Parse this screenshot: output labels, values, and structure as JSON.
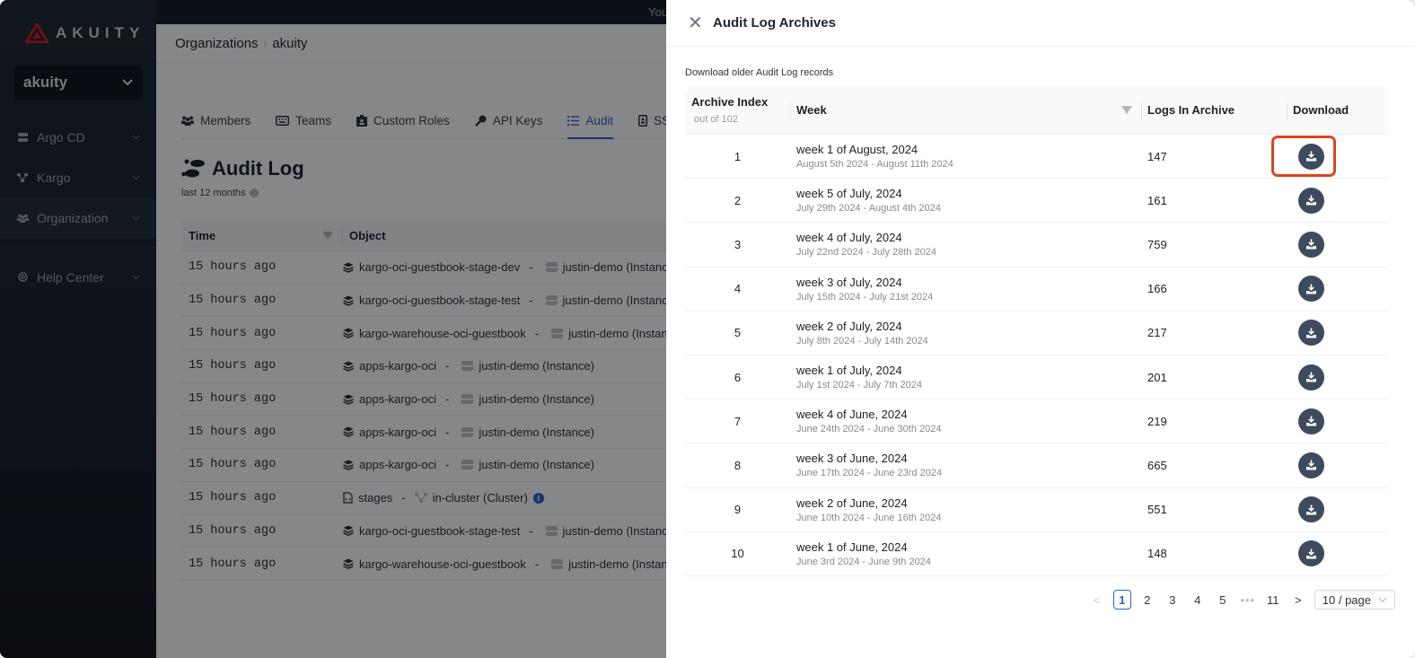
{
  "brand": {
    "name": "AKUITY",
    "accent": "#c4212b"
  },
  "sidebar": {
    "org_selector": "akuity",
    "items": [
      {
        "label": "Argo CD",
        "icon": "server-icon",
        "active": false
      },
      {
        "label": "Kargo",
        "icon": "network-icon",
        "active": false
      },
      {
        "label": "Organization",
        "icon": "users-icon",
        "active": true
      },
      {
        "label": "Help Center",
        "icon": "lifebuoy-icon",
        "active": false
      }
    ]
  },
  "topbar": {
    "user_text": "You"
  },
  "breadcrumb": {
    "root": "Organizations",
    "current": "akuity"
  },
  "tabs": [
    {
      "label": "Members",
      "icon": "users-icon"
    },
    {
      "label": "Teams",
      "icon": "keyboard-icon"
    },
    {
      "label": "Custom Roles",
      "icon": "id-badge-icon"
    },
    {
      "label": "API Keys",
      "icon": "key-icon"
    },
    {
      "label": "Audit",
      "icon": "list-icon",
      "active": true
    },
    {
      "label": "SSO",
      "icon": "id-card-icon"
    }
  ],
  "audit": {
    "title": "Audit Log",
    "subtitle": "last 12 months",
    "columns": {
      "time": "Time",
      "object": "Object"
    },
    "rows": [
      {
        "time": "15 hours ago",
        "object": "kargo-oci-guestbook-stage-dev",
        "separator": "-",
        "target": "justin-demo (Instance)",
        "kind": "stack"
      },
      {
        "time": "15 hours ago",
        "object": "kargo-oci-guestbook-stage-test",
        "separator": "-",
        "target": "justin-demo (Instance)",
        "kind": "stack"
      },
      {
        "time": "15 hours ago",
        "object": "kargo-warehouse-oci-guestbook",
        "separator": "-",
        "target": "justin-demo (Instance)",
        "kind": "stack"
      },
      {
        "time": "15 hours ago",
        "object": "apps-kargo-oci",
        "separator": "-",
        "target": "justin-demo (Instance)",
        "kind": "stack"
      },
      {
        "time": "15 hours ago",
        "object": "apps-kargo-oci",
        "separator": "-",
        "target": "justin-demo (Instance)",
        "kind": "stack"
      },
      {
        "time": "15 hours ago",
        "object": "apps-kargo-oci",
        "separator": "-",
        "target": "justin-demo (Instance)",
        "kind": "stack"
      },
      {
        "time": "15 hours ago",
        "object": "apps-kargo-oci",
        "separator": "-",
        "target": "justin-demo (Instance)",
        "kind": "stack"
      },
      {
        "time": "15 hours ago",
        "object": "stages",
        "separator": "-",
        "target": "in-cluster (Cluster)",
        "kind": "file",
        "info": "i"
      },
      {
        "time": "15 hours ago",
        "object": "kargo-oci-guestbook-stage-test",
        "separator": "-",
        "target": "justin-demo (Instance)",
        "kind": "stack"
      },
      {
        "time": "15 hours ago",
        "object": "kargo-warehouse-oci-guestbook",
        "separator": "-",
        "target": "justin-demo (Instance)",
        "kind": "stack"
      }
    ]
  },
  "drawer": {
    "title": "Audit Log Archives",
    "description": "Download older Audit Log records",
    "columns": {
      "index": "Archive Index",
      "index_sub": "out of 102",
      "week": "Week",
      "logs": "Logs In Archive",
      "download": "Download"
    },
    "rows": [
      {
        "index": "1",
        "week": "week 1 of August, 2024",
        "range": "August 5th 2024 - August 11th 2024",
        "logs": "147",
        "highlighted": true
      },
      {
        "index": "2",
        "week": "week 5 of July, 2024",
        "range": "July 29th 2024 - August 4th 2024",
        "logs": "161"
      },
      {
        "index": "3",
        "week": "week 4 of July, 2024",
        "range": "July 22nd 2024 - July 28th 2024",
        "logs": "759"
      },
      {
        "index": "4",
        "week": "week 3 of July, 2024",
        "range": "July 15th 2024 - July 21st 2024",
        "logs": "166"
      },
      {
        "index": "5",
        "week": "week 2 of July, 2024",
        "range": "July 8th 2024 - July 14th 2024",
        "logs": "217"
      },
      {
        "index": "6",
        "week": "week 1 of July, 2024",
        "range": "July 1st 2024 - July 7th 2024",
        "logs": "201"
      },
      {
        "index": "7",
        "week": "week 4 of June, 2024",
        "range": "June 24th 2024 - June 30th 2024",
        "logs": "219"
      },
      {
        "index": "8",
        "week": "week 3 of June, 2024",
        "range": "June 17th 2024 - June 23rd 2024",
        "logs": "665"
      },
      {
        "index": "9",
        "week": "week 2 of June, 2024",
        "range": "June 10th 2024 - June 16th 2024",
        "logs": "551"
      },
      {
        "index": "10",
        "week": "week 1 of June, 2024",
        "range": "June 3rd 2024 - June 9th 2024",
        "logs": "148"
      }
    ],
    "pagination": {
      "prev": "<",
      "pages": [
        "1",
        "2",
        "3",
        "4",
        "5"
      ],
      "current": "1",
      "dots": "•••",
      "last": "11",
      "next": ">",
      "page_size": "10 / page"
    }
  }
}
